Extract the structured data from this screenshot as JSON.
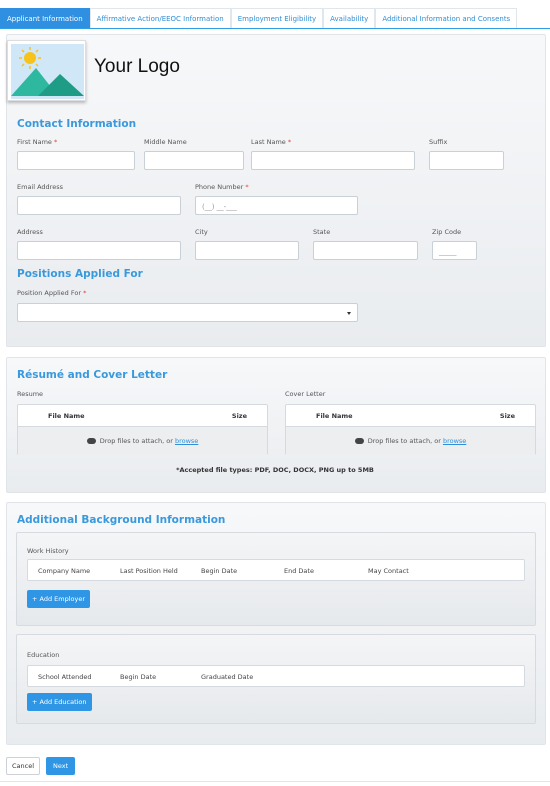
{
  "tabs": [
    {
      "label": "Applicant Information"
    },
    {
      "label": "Affirmative Action/EEOC Information"
    },
    {
      "label": "Employment Eligibility"
    },
    {
      "label": "Availability"
    },
    {
      "label": "Additional Information and Consents"
    }
  ],
  "logo": {
    "text": "Your Logo"
  },
  "contact": {
    "title": "Contact Information",
    "first_name": "First Name",
    "middle_name": "Middle Name",
    "last_name": "Last Name",
    "suffix": "Suffix",
    "email": "Email Address",
    "phone": "Phone Number",
    "phone_placeholder": "(__) __-___",
    "address": "Address",
    "city": "City",
    "state": "State",
    "zip": "Zip Code",
    "zip_placeholder": "_____"
  },
  "positions": {
    "title": "Positions Applied For",
    "label": "Position Applied For"
  },
  "resume": {
    "title": "Résumé and Cover Letter",
    "resume_label": "Resume",
    "cover_label": "Cover Letter",
    "col_file": "File Name",
    "col_size": "Size",
    "drop_text": "Drop files to attach, or ",
    "browse": "browse",
    "accepted": "*Accepted file types: PDF, DOC, DOCX, PNG up to 5MB"
  },
  "background": {
    "title": "Additional Background Information",
    "work_title": "Work History",
    "work_cols": [
      "Company Name",
      "Last Position Held",
      "Begin Date",
      "End Date",
      "May Contact"
    ],
    "add_employer": "+ Add Employer",
    "edu_title": "Education",
    "edu_cols": [
      "School Attended",
      "Begin Date",
      "Graduated Date"
    ],
    "add_education": "+ Add Education"
  },
  "footer": {
    "cancel": "Cancel",
    "next": "Next"
  },
  "colors": {
    "accent": "#2f8fe0",
    "required": "#e0403a"
  }
}
